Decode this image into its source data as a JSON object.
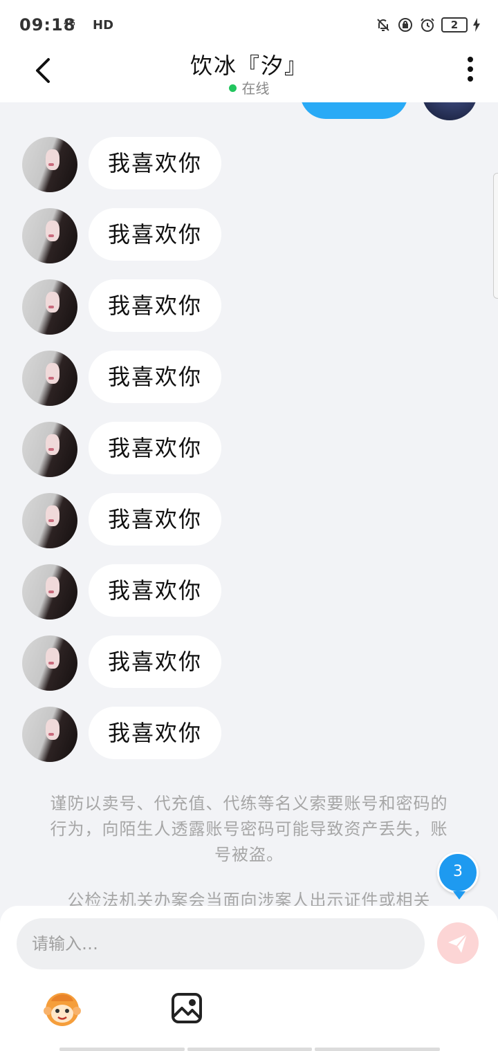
{
  "status_bar": {
    "time": "09:18",
    "network": "4G",
    "hd": "HD",
    "battery": "2"
  },
  "header": {
    "title": "饮冰『汐』",
    "presence": "在线",
    "presence_color": "#22c55e"
  },
  "messages": [
    {
      "text": "我喜欢你"
    },
    {
      "text": "我喜欢你"
    },
    {
      "text": "我喜欢你"
    },
    {
      "text": "我喜欢你"
    },
    {
      "text": "我喜欢你"
    },
    {
      "text": "我喜欢你"
    },
    {
      "text": "我喜欢你"
    },
    {
      "text": "我喜欢你"
    },
    {
      "text": "我喜欢你"
    }
  ],
  "notice": {
    "text": "谨防以卖号、代充值、代练等名义索要账号和密码的行为，向陌生人透露账号密码可能导致资产丢失，账号被盗。",
    "text2": "公检法机关办案会当面向涉案人出示证件或相关"
  },
  "unread_badge": "3",
  "input": {
    "placeholder": "请输入…"
  },
  "colors": {
    "accent": "#1e9af0",
    "sent_bubble": "#29aaf6",
    "send_button": "#fcd5d5"
  }
}
